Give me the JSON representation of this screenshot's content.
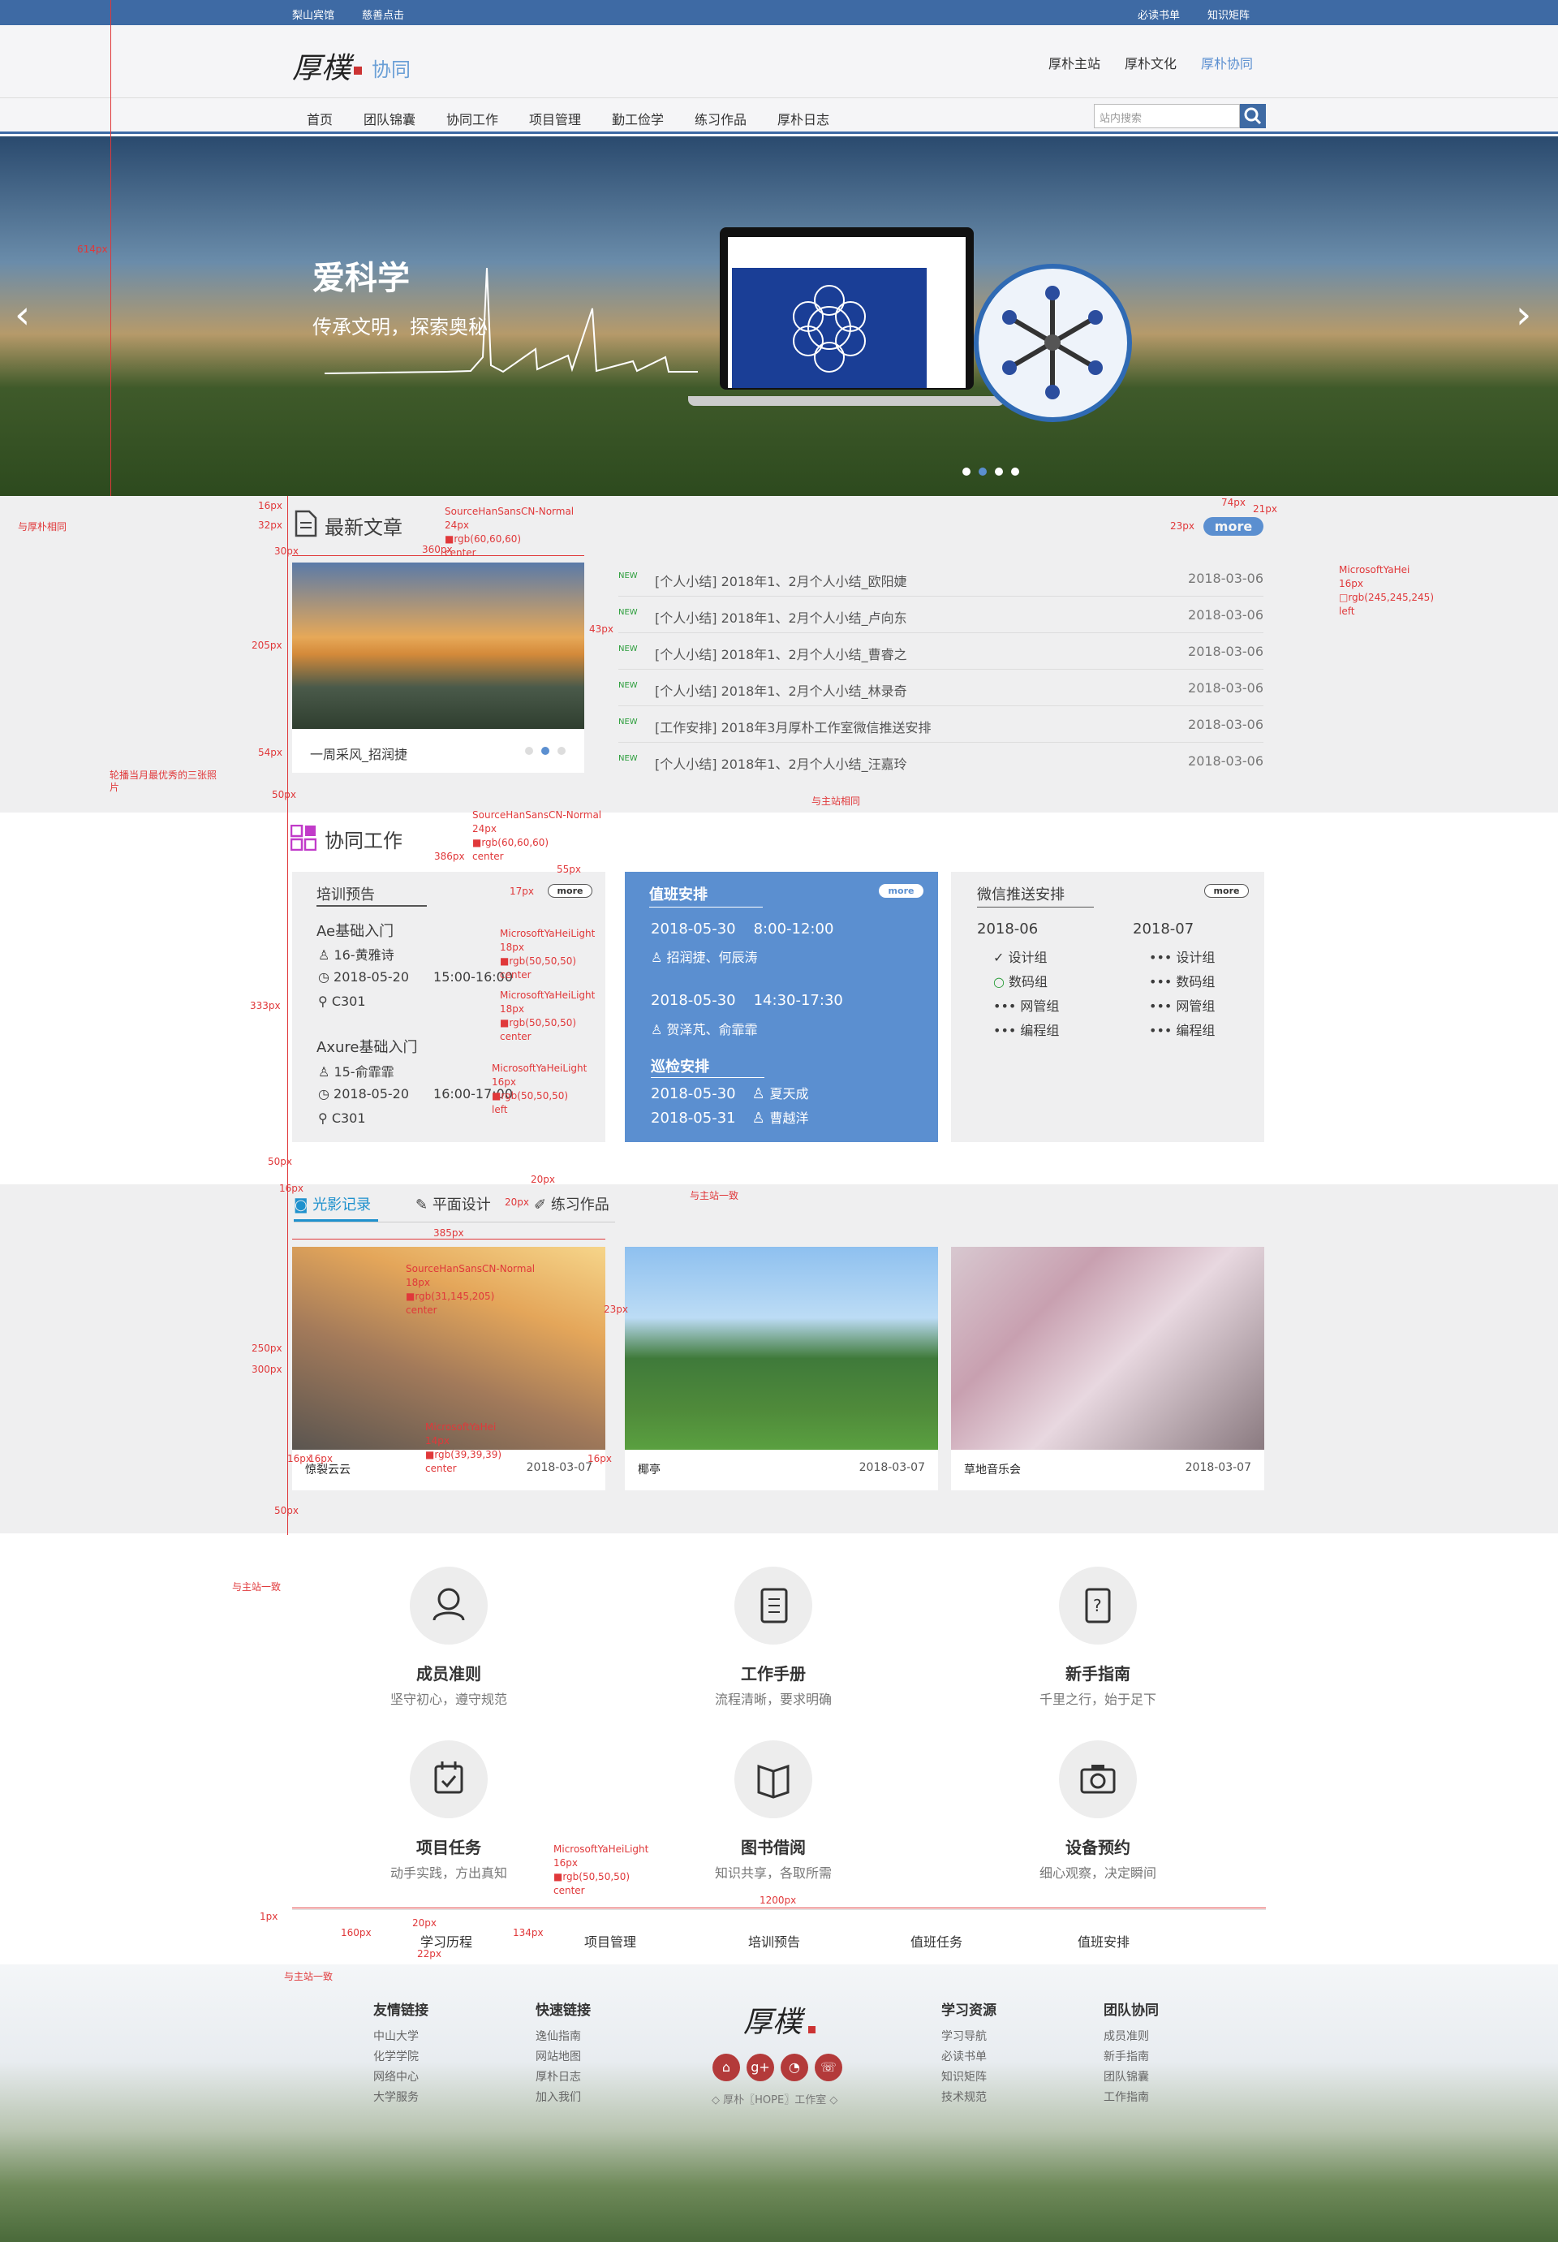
{
  "topbar": {
    "left1": "梨山宾馆",
    "left2": "慈善点击",
    "right1": "必读书单",
    "right2": "知识矩阵"
  },
  "header": {
    "logo": "厚樸",
    "subtitle": "协同",
    "links": [
      "厚朴主站",
      "厚朴文化",
      "厚朴协同"
    ]
  },
  "nav": {
    "items": [
      "首页",
      "团队锦囊",
      "协同工作",
      "项目管理",
      "勤工俭学",
      "练习作品",
      "厚朴日志"
    ],
    "search_placeholder": "站内搜索"
  },
  "banner": {
    "title": "爱科学",
    "subtitle": "传承文明，探索奥秘",
    "slides": 4,
    "active_slide": 2
  },
  "articles": {
    "title": "最新文章",
    "more": "more",
    "photo_caption": "一周采风_招润捷",
    "rows": [
      {
        "tag": "NEW",
        "text": "[个人小结] 2018年1、2月个人小结_欧阳婕",
        "date": "2018-03-06"
      },
      {
        "tag": "NEW",
        "text": "[个人小结] 2018年1、2月个人小结_卢向东",
        "date": "2018-03-06"
      },
      {
        "tag": "NEW",
        "text": "[个人小结] 2018年1、2月个人小结_曹睿之",
        "date": "2018-03-06"
      },
      {
        "tag": "NEW",
        "text": "[个人小结] 2018年1、2月个人小结_林录奇",
        "date": "2018-03-06"
      },
      {
        "tag": "NEW",
        "text": "[工作安排] 2018年3月厚朴工作室微信推送安排",
        "date": "2018-03-06"
      },
      {
        "tag": "NEW",
        "text": "[个人小结] 2018年1、2月个人小结_汪嘉玲",
        "date": "2018-03-06"
      }
    ]
  },
  "collab": {
    "title": "协同工作",
    "training": {
      "title": "培训预告",
      "more": "more",
      "courses": [
        {
          "name": "Ae基础入门",
          "person": "16-黄雅诗",
          "date": "2018-05-20",
          "time": "15:00-16:00",
          "room": "C301"
        },
        {
          "name": "Axure基础入门",
          "person": "15-俞霏霏",
          "date": "2018-05-20",
          "time": "16:00-17:00",
          "room": "C301"
        }
      ]
    },
    "duty": {
      "title": "值班安排",
      "more": "more",
      "slots": [
        {
          "date": "2018-05-30",
          "time": "8:00-12:00",
          "people": "招润捷、何辰涛"
        },
        {
          "date": "2018-05-30",
          "time": "14:30-17:30",
          "people": "贺泽芃、俞霏霏"
        }
      ],
      "patrol_title": "巡检安排",
      "patrol": [
        {
          "date": "2018-05-30",
          "person": "夏天成"
        },
        {
          "date": "2018-05-31",
          "person": "曹越洋"
        }
      ]
    },
    "wechat": {
      "title": "微信推送安排",
      "more": "more",
      "months": [
        "2018-06",
        "2018-07"
      ],
      "groups": [
        "设计组",
        "数码组",
        "网管组",
        "编程组"
      ]
    }
  },
  "gallery": {
    "tabs": [
      "光影记录",
      "平面设计",
      "练习作品"
    ],
    "items": [
      {
        "caption": "惊裂云云",
        "date": "2018-03-07"
      },
      {
        "caption": "椰亭",
        "date": "2018-03-07"
      },
      {
        "caption": "草地音乐会",
        "date": "2018-03-07"
      }
    ]
  },
  "features": [
    {
      "title": "成员准则",
      "sub": "坚守初心，遵守规范",
      "icon": "person-icon"
    },
    {
      "title": "工作手册",
      "sub": "流程清晰，要求明确",
      "icon": "notebook-icon"
    },
    {
      "title": "新手指南",
      "sub": "千里之行，始于足下",
      "icon": "help-doc-icon"
    },
    {
      "title": "项目任务",
      "sub": "动手实践，方出真知",
      "icon": "calendar-check-icon"
    },
    {
      "title": "图书借阅",
      "sub": "知识共享，各取所需",
      "icon": "book-icon"
    },
    {
      "title": "设备预约",
      "sub": "细心观察，决定瞬间",
      "icon": "camera-icon"
    }
  ],
  "bottom_links": [
    "学习历程",
    "项目管理",
    "培训预告",
    "值班任务",
    "值班安排"
  ],
  "footer": {
    "cols": [
      {
        "title": "友情链接",
        "items": [
          "中山大学",
          "化学学院",
          "网络中心",
          "大学服务"
        ]
      },
      {
        "title": "快速链接",
        "items": [
          "逸仙指南",
          "网站地图",
          "厚朴日志",
          "加入我们"
        ]
      },
      {
        "title": "学习资源",
        "items": [
          "学习导航",
          "必读书单",
          "知识矩阵",
          "技术规范"
        ]
      },
      {
        "title": "团队协同",
        "items": [
          "成员准则",
          "新手指南",
          "团队锦囊",
          "工作指南"
        ]
      }
    ],
    "logo": "厚樸",
    "copyright": "◇ 厚朴〖HOPE〗工作室 ◇"
  },
  "annotations": {
    "a_banner": "614px",
    "a_rel": "与厚朴相同",
    "a_16": "16px",
    "a_32": "32px",
    "a_30": "30px",
    "a_360": "360px",
    "a_font1": "SourceHanSansCN-Normal",
    "a_24": "24px",
    "a_rgb60": "■rgb(60,60,60)",
    "a_center": "center",
    "a_74": "74px",
    "a_21": "21px",
    "a_23": "23px",
    "a_ms": "MicrosoftYaHei",
    "a_ms16": "16px",
    "a_rgb245": "□rgb(245,245,245)",
    "a_left": "left",
    "a_205": "205px",
    "a_43": "43px",
    "a_54": "54px",
    "a_50": "50px",
    "a_carousel": "轮播当月最优秀的三张照片",
    "a_same": "与主站相同",
    "a_386": "386px",
    "a_55": "55px",
    "a_17": "17px",
    "a_msl": "MicrosoftYaHeiLight",
    "a_18": "18px",
    "a_rgb50": "■rgb(50,50,50)",
    "a_333": "333px",
    "a_385": "385px",
    "a_250": "250px",
    "a_300": "300px",
    "a_rgb31": "■rgb(31,145,205)",
    "a_14": "14px",
    "a_rgb39": "■rgb(39,39,39)",
    "a_same2": "与主站一致",
    "a_1200": "1200px",
    "a_1px": "1px",
    "a_160": "160px",
    "a_134": "134px",
    "a_22": "22px",
    "a_20": "20px"
  }
}
